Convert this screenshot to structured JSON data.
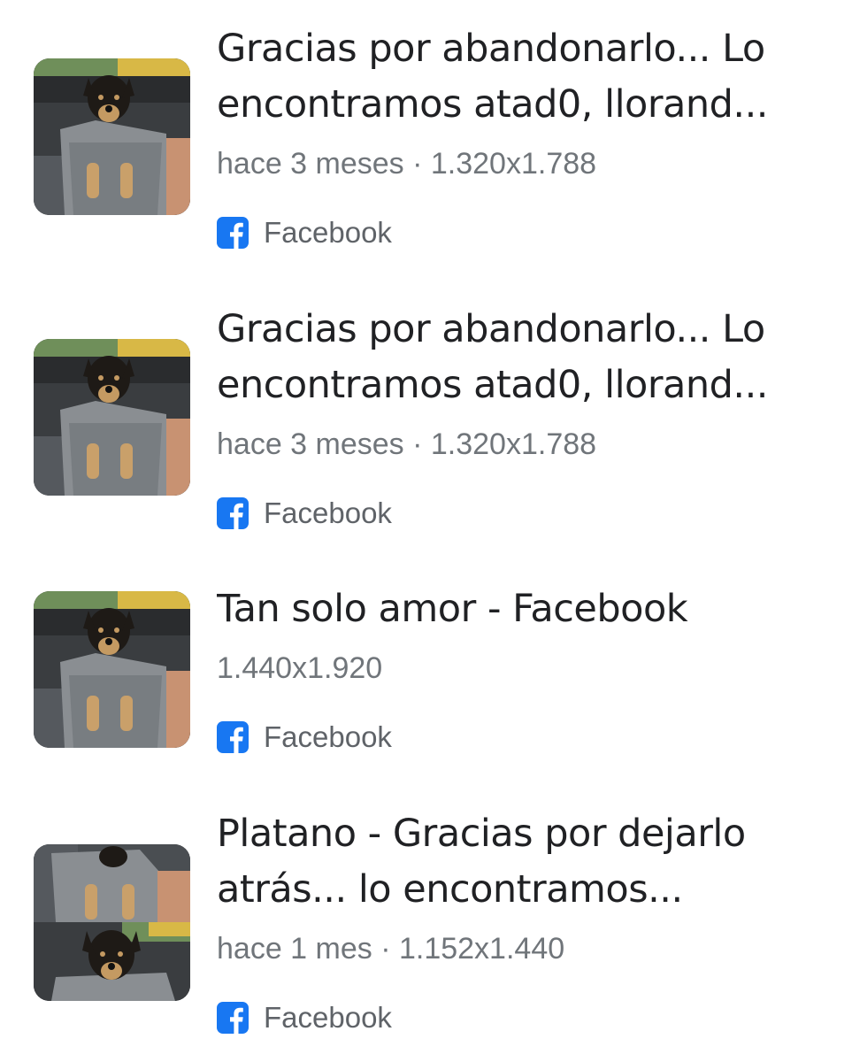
{
  "results": [
    {
      "title_line1": "Gracias por abandonarlo... Lo",
      "title_line2": "encontramos atad0, llorand...",
      "meta": "hace 3 meses · 1.320x1.788",
      "source": "Facebook",
      "thumbnail_icon": "puppy-thumbnail"
    },
    {
      "title_line1": "Gracias por abandonarlo... Lo",
      "title_line2": "encontramos atad0, llorand...",
      "meta": "hace 3 meses · 1.320x1.788",
      "source": "Facebook",
      "thumbnail_icon": "puppy-thumbnail"
    },
    {
      "title_line1": "Tan solo amor - Facebook",
      "meta": "1.440x1.920",
      "source": "Facebook",
      "thumbnail_icon": "puppy-thumbnail"
    },
    {
      "title_line1": "Platano - Gracias por dejarlo",
      "title_line2": "atrás... lo encontramos...",
      "meta": "hace 1 mes · 1.152x1.440",
      "source": "Facebook",
      "thumbnail_icon": "puppy-collage-thumbnail"
    }
  ],
  "colors": {
    "title": "#202124",
    "meta": "#70757a",
    "facebook_blue": "#1877f2"
  }
}
